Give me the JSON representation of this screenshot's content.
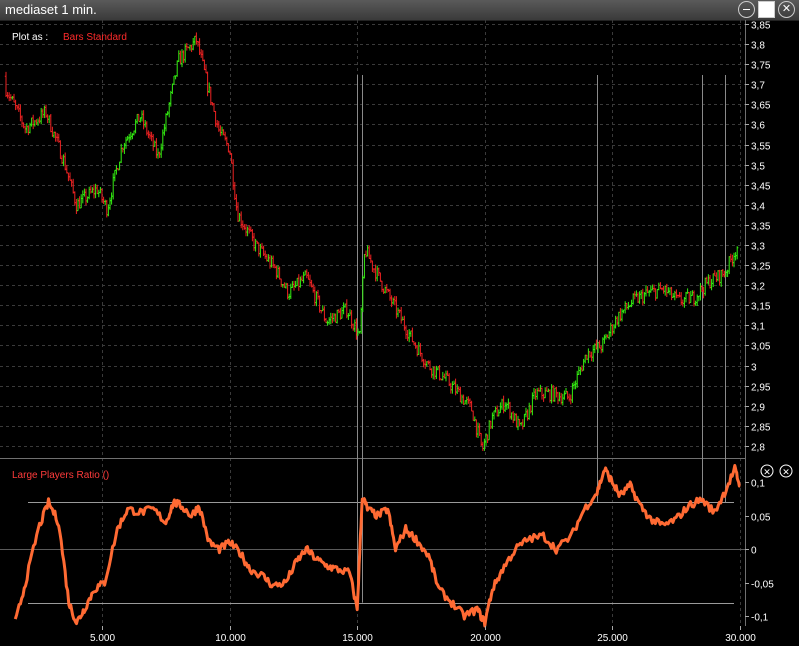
{
  "window": {
    "title": "mediaset  1 min.",
    "close_glyph": "✕"
  },
  "plot_as": {
    "label": "Plot as :",
    "value": "Bars Standard"
  },
  "chart_data": [
    {
      "type": "bar",
      "style": "OHLC bars",
      "ylim": [
        2.77,
        3.86
      ],
      "yticks": [
        3.85,
        3.8,
        3.75,
        3.7,
        3.65,
        3.6,
        3.55,
        3.5,
        3.45,
        3.4,
        3.35,
        3.3,
        3.25,
        3.2,
        3.15,
        3.1,
        3.05,
        3.0,
        2.95,
        2.9,
        2.85,
        2.8
      ],
      "ytick_labels": [
        "3,85",
        "3,8",
        "3,75",
        "3,7",
        "3,65",
        "3,6",
        "3,55",
        "3,5",
        "3,45",
        "3,4",
        "3,35",
        "3,3",
        "3,25",
        "3,2",
        "3,15",
        "3,1",
        "3,05",
        "3",
        "2,95",
        "2,9",
        "2,85",
        "2,8"
      ],
      "xlim": [
        1000,
        30200
      ],
      "grid": true,
      "colors": {
        "up": "#33ee11",
        "down": "#ee2222"
      },
      "series": [
        {
          "x": [
            1000,
            2000,
            2800,
            3500,
            4000,
            4800,
            5200,
            5800,
            6500,
            7200,
            7600,
            8000,
            8700,
            9200,
            9600,
            10000,
            10300,
            11000,
            11800,
            12300,
            13000,
            13800,
            14600,
            15100,
            15300,
            15600,
            16000,
            16600,
            17200,
            17800,
            18400,
            19000,
            19500,
            19900,
            20300,
            20800,
            21400,
            22000,
            22600,
            23300,
            24000,
            24600,
            25200,
            25800,
            26400,
            27000,
            27600,
            28200,
            28800,
            29400,
            30000
          ],
          "y": [
            3.72,
            3.59,
            3.63,
            3.51,
            3.4,
            3.44,
            3.39,
            3.55,
            3.62,
            3.52,
            3.64,
            3.76,
            3.81,
            3.68,
            3.58,
            3.54,
            3.38,
            3.3,
            3.24,
            3.18,
            3.22,
            3.11,
            3.14,
            3.07,
            3.29,
            3.25,
            3.2,
            3.13,
            3.06,
            3.0,
            2.97,
            2.93,
            2.89,
            2.79,
            2.87,
            2.91,
            2.84,
            2.93,
            2.93,
            2.92,
            3.03,
            3.05,
            3.12,
            3.16,
            3.18,
            3.19,
            3.16,
            3.17,
            3.21,
            3.23,
            3.31
          ]
        }
      ]
    },
    {
      "type": "line",
      "title": "Large Players Ratio ()",
      "ylim": [
        -0.115,
        0.135
      ],
      "yticks": [
        0.1,
        0.05,
        0,
        -0.05,
        -0.1
      ],
      "ytick_labels": [
        "0,1",
        "0,05",
        "0",
        "-0,05",
        "-0,1"
      ],
      "reference_levels": [
        0.07,
        -0.08
      ],
      "xlim": [
        1000,
        30200
      ],
      "xticks": [
        5000,
        10000,
        15000,
        20000,
        25000,
        30000
      ],
      "xtick_labels": [
        "5.000",
        "10.000",
        "15.000",
        "20.000",
        "25.000",
        "30.000"
      ],
      "color": "#ff6a33",
      "series": [
        {
          "x": [
            1600,
            2000,
            2500,
            2900,
            3300,
            3700,
            4000,
            4300,
            4700,
            5100,
            5600,
            6000,
            6500,
            7000,
            7500,
            7800,
            8100,
            8500,
            8800,
            9200,
            9600,
            10000,
            10400,
            10800,
            11300,
            11700,
            12200,
            12600,
            13000,
            13400,
            13800,
            14200,
            14700,
            15000,
            15200,
            15400,
            15800,
            16200,
            16500,
            16900,
            17300,
            17800,
            18200,
            18700,
            19200,
            19700,
            20000,
            20300,
            20700,
            21200,
            21700,
            22300,
            22800,
            23400,
            23900,
            24400,
            24700,
            25000,
            25300,
            25700,
            26100,
            26500,
            27000,
            27500,
            28000,
            28500,
            29000,
            29400,
            29800,
            30000
          ],
          "y": [
            -0.11,
            -0.05,
            0.03,
            0.07,
            0.04,
            -0.08,
            -0.11,
            -0.09,
            -0.06,
            -0.05,
            0.03,
            0.06,
            0.055,
            0.06,
            0.04,
            0.07,
            0.065,
            0.05,
            0.065,
            0.01,
            0.0,
            0.01,
            -0.005,
            -0.03,
            -0.04,
            -0.055,
            -0.05,
            -0.02,
            0.0,
            -0.015,
            -0.025,
            -0.03,
            -0.035,
            -0.09,
            0.08,
            0.06,
            0.05,
            0.06,
            0.0,
            0.03,
            0.015,
            -0.01,
            -0.06,
            -0.08,
            -0.1,
            -0.09,
            -0.11,
            -0.06,
            -0.03,
            0.0,
            0.015,
            0.02,
            0.0,
            0.02,
            0.06,
            0.085,
            0.12,
            0.1,
            0.08,
            0.095,
            0.065,
            0.045,
            0.035,
            0.045,
            0.065,
            0.075,
            0.055,
            0.085,
            0.12,
            0.095
          ]
        }
      ]
    }
  ]
}
